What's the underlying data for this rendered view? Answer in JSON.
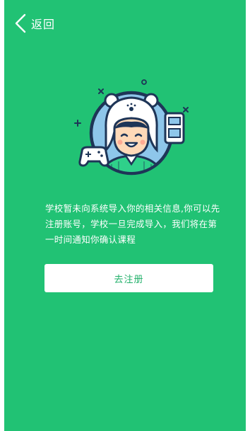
{
  "header": {
    "back_label": "返回"
  },
  "message": "学校暂未向系统导入你的相关信息,你可以先注册账号，学校一旦完成导入，我们将在第一时间通知你确认课程",
  "actions": {
    "register_label": "去注册"
  },
  "colors": {
    "background": "#21c274",
    "button_text": "#21b06a",
    "illustration_navy": "#1e3557",
    "illustration_blue": "#8ec6ea"
  },
  "icons": {
    "back": "chevron-left-icon",
    "illustration": "student-bear-hat-icon",
    "gamepad": "gamepad-icon",
    "game_console": "handheld-console-icon"
  }
}
